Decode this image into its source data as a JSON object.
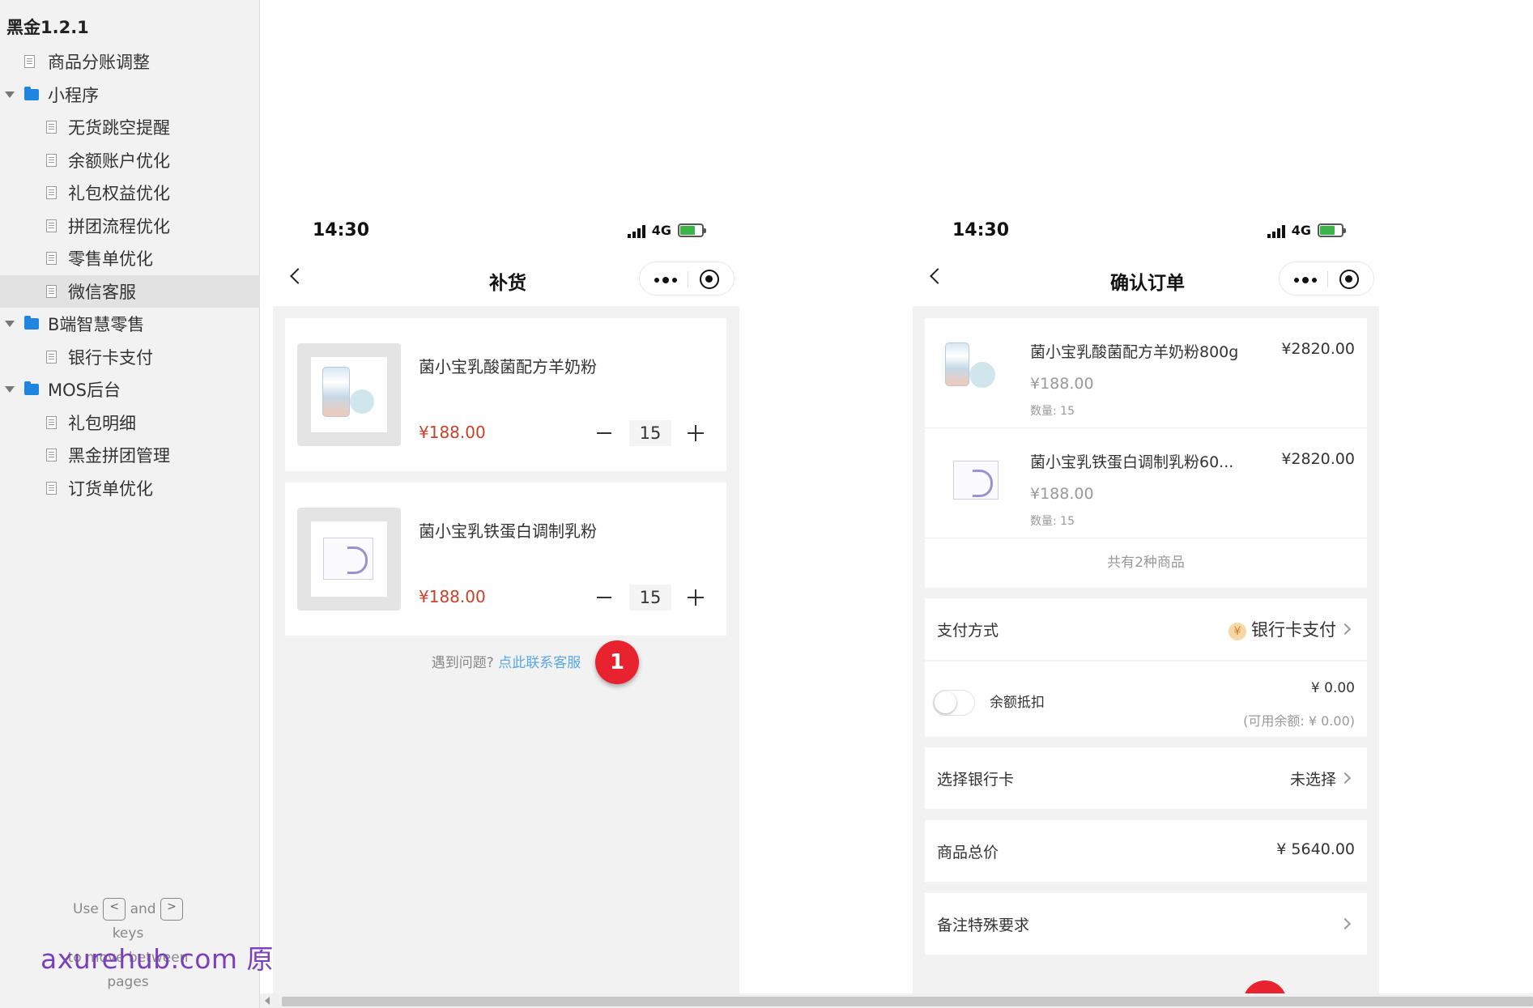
{
  "sidebar": {
    "project_title": "黑金1.2.1",
    "items": [
      {
        "label": "商品分账调整"
      },
      {
        "label": "小程序"
      },
      {
        "label": "无货跳空提醒"
      },
      {
        "label": "余额账户优化"
      },
      {
        "label": "礼包权益优化"
      },
      {
        "label": "拼团流程优化"
      },
      {
        "label": "零售单优化"
      },
      {
        "label": "微信客服"
      },
      {
        "label": "B端智慧零售"
      },
      {
        "label": "银行卡支付"
      },
      {
        "label": "MOS后台"
      },
      {
        "label": "礼包明细"
      },
      {
        "label": "黑金拼团管理"
      },
      {
        "label": "订货单优化"
      }
    ],
    "selected": "微信客服",
    "help": {
      "use": "Use",
      "key_prev": "<",
      "and": "and",
      "key_next": ">",
      "keys": "keys",
      "to_move": "to move between",
      "pages": "pages"
    },
    "watermark": "axurehub.com 原型资源站"
  },
  "phone1": {
    "time": "14:30",
    "network": "4G",
    "title": "补货",
    "products": [
      {
        "name": "菌小宝乳酸菌配方羊奶粉",
        "price": "¥188.00",
        "qty": "15"
      },
      {
        "name": "菌小宝乳铁蛋白调制乳粉",
        "price": "¥188.00",
        "qty": "15"
      }
    ],
    "help_text": "遇到问题?",
    "help_link": "点此联系客服",
    "badge": "1"
  },
  "phone2": {
    "time": "14:30",
    "network": "4G",
    "title": "确认订单",
    "items": [
      {
        "name": "菌小宝乳酸菌配方羊奶粉800g",
        "amount": "¥2820.00",
        "price": "¥188.00",
        "qty": "数量: 15"
      },
      {
        "name": "菌小宝乳铁蛋白调制乳粉60...",
        "amount": "¥2820.00",
        "price": "¥188.00",
        "qty": "数量: 15"
      }
    ],
    "summary": "共有2种商品",
    "payment": {
      "label": "支付方式",
      "value": "银行卡支付",
      "icon": "¥"
    },
    "balance": {
      "label": "余额抵扣",
      "amount": "¥ 0.00",
      "available": "(可用余额: ¥ 0.00)"
    },
    "bank_card": {
      "label": "选择银行卡",
      "value": "未选择"
    },
    "total": {
      "label": "商品总价",
      "value": "¥ 5640.00"
    },
    "remark": {
      "label": "备注特殊要求"
    }
  }
}
